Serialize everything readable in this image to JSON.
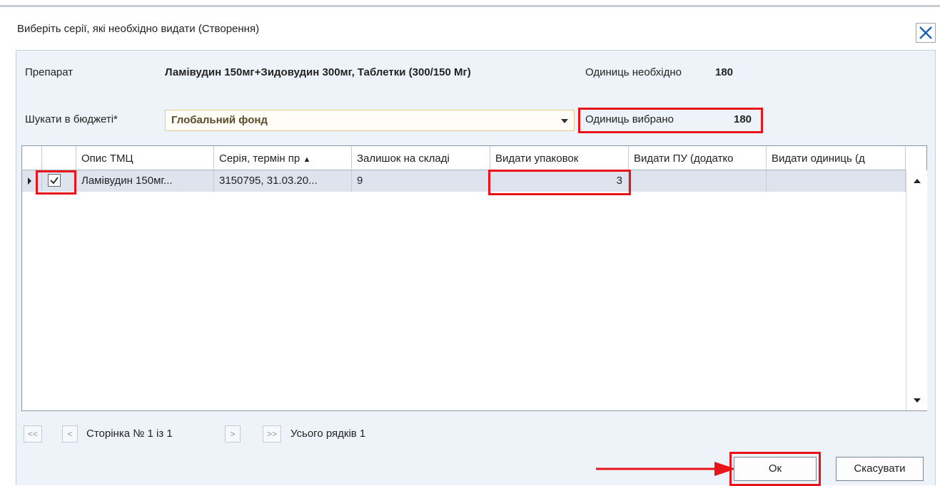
{
  "dialog": {
    "title": "Виберіть серії, які необхідно видати (Створення)"
  },
  "form": {
    "drug_label": "Препарат",
    "drug_name": "Ламівудин 150мг+Зидовудин 300мг, Таблетки (300/150 Мг)",
    "units_needed_label": "Одиниць необхідно",
    "units_needed_value": "180",
    "budget_label": "Шукати в бюджеті*",
    "budget_value": "Глобальний фонд",
    "units_selected_label": "Одиниць вибрано",
    "units_selected_value": "180"
  },
  "grid": {
    "columns": [
      "Опис ТМЦ",
      "Серія, термін пр",
      "Залишок на складі",
      "Видати упаковок",
      "Видати ПУ (додатко",
      "Видати одиниць (д"
    ],
    "rows": [
      {
        "checked": true,
        "description": "Ламівудин 150мг...",
        "series": "3150795, 31.03.20...",
        "stock": "9",
        "packs": "3",
        "pu": "",
        "units": ""
      }
    ]
  },
  "pager": {
    "first": "<<",
    "prev": "<",
    "page_text": "Сторінка № 1 із 1",
    "next": ">",
    "last": ">>",
    "total_text": "Усього рядків 1"
  },
  "buttons": {
    "ok": "Ок",
    "cancel": "Скасувати"
  },
  "colors": {
    "highlight": "#e8141a",
    "panel_bg": "#eef3f9",
    "selected_row": "#dfe3ee",
    "combo_border": "#e7c98a",
    "close_x": "#1e5fb4"
  }
}
